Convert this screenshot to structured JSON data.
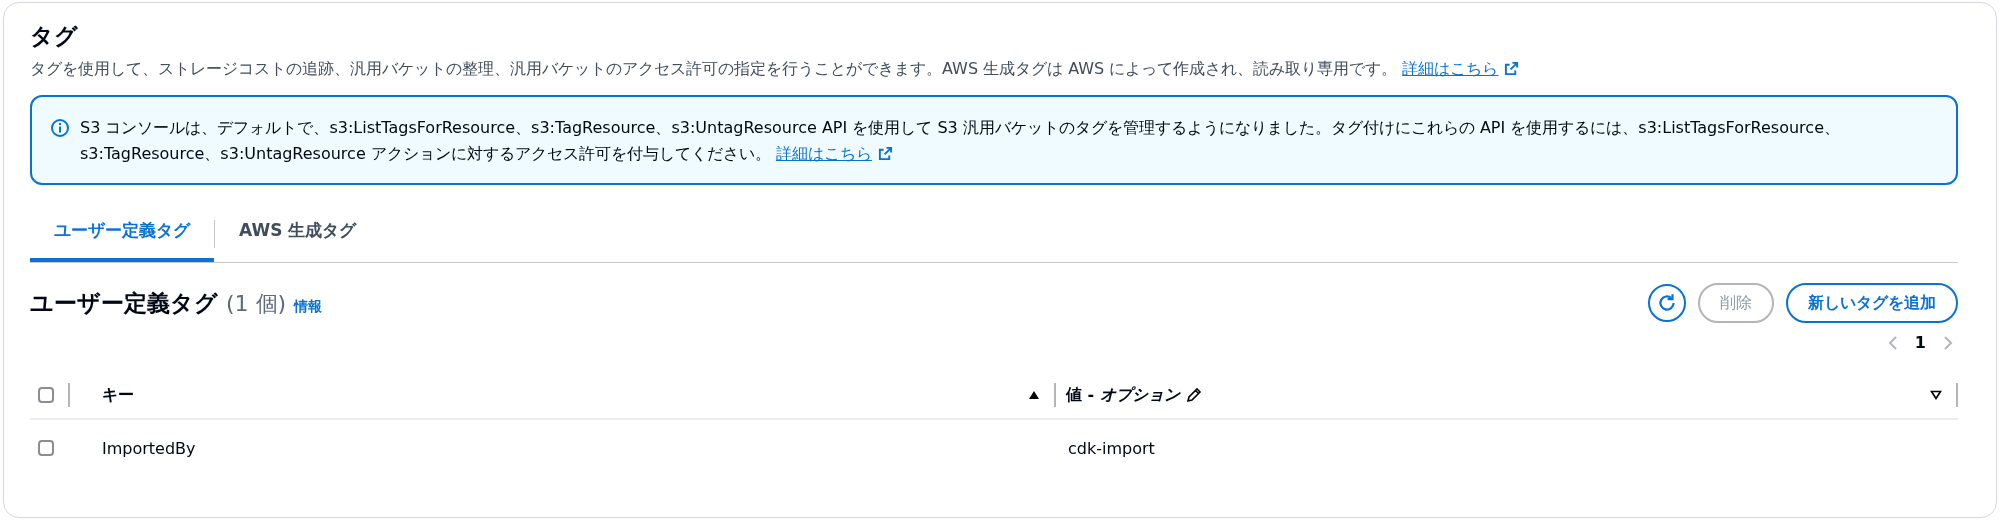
{
  "section": {
    "title": "タグ",
    "description": "タグを使用して、ストレージコストの追跡、汎用バケットの整理、汎用バケットのアクセス許可の指定を行うことができます。AWS 生成タグは AWS によって作成され、読み取り専用です。",
    "link": "詳細はこちら"
  },
  "alert": {
    "text": "S3 コンソールは、デフォルトで、s3:ListTagsForResource、s3:TagResource、s3:UntagResource API を使用して S3 汎用バケットのタグを管理するようになりました。タグ付けにこれらの API を使用するには、s3:ListTagsForResource、s3:TagResource、s3:UntagResource アクションに対するアクセス許可を付与してください。",
    "link": "詳細はこちら"
  },
  "tabs": [
    {
      "label": "ユーザー定義タグ",
      "selected": true
    },
    {
      "label": "AWS 生成タグ",
      "selected": false
    }
  ],
  "table": {
    "title": "ユーザー定義タグ",
    "count": "(1 個)",
    "info": "情報",
    "buttons": [
      {
        "kind": "refresh",
        "disabled": false
      },
      {
        "kind": "text",
        "label": "削除",
        "disabled": true
      },
      {
        "kind": "text",
        "label": "新しいタグを追加",
        "disabled": false
      }
    ],
    "pagination": {
      "page": "1",
      "prev_disabled": true,
      "next_disabled": true
    },
    "select_all": {
      "checked": false
    },
    "columns": [
      {
        "label": "キー",
        "sorted": true,
        "editable": false
      },
      {
        "label": "値 - *オプション*",
        "sorted": false,
        "editable": true
      }
    ],
    "rows": [
      {
        "checked": false,
        "cells": [
          "ImportedBy",
          "cdk-import"
        ]
      }
    ]
  }
}
